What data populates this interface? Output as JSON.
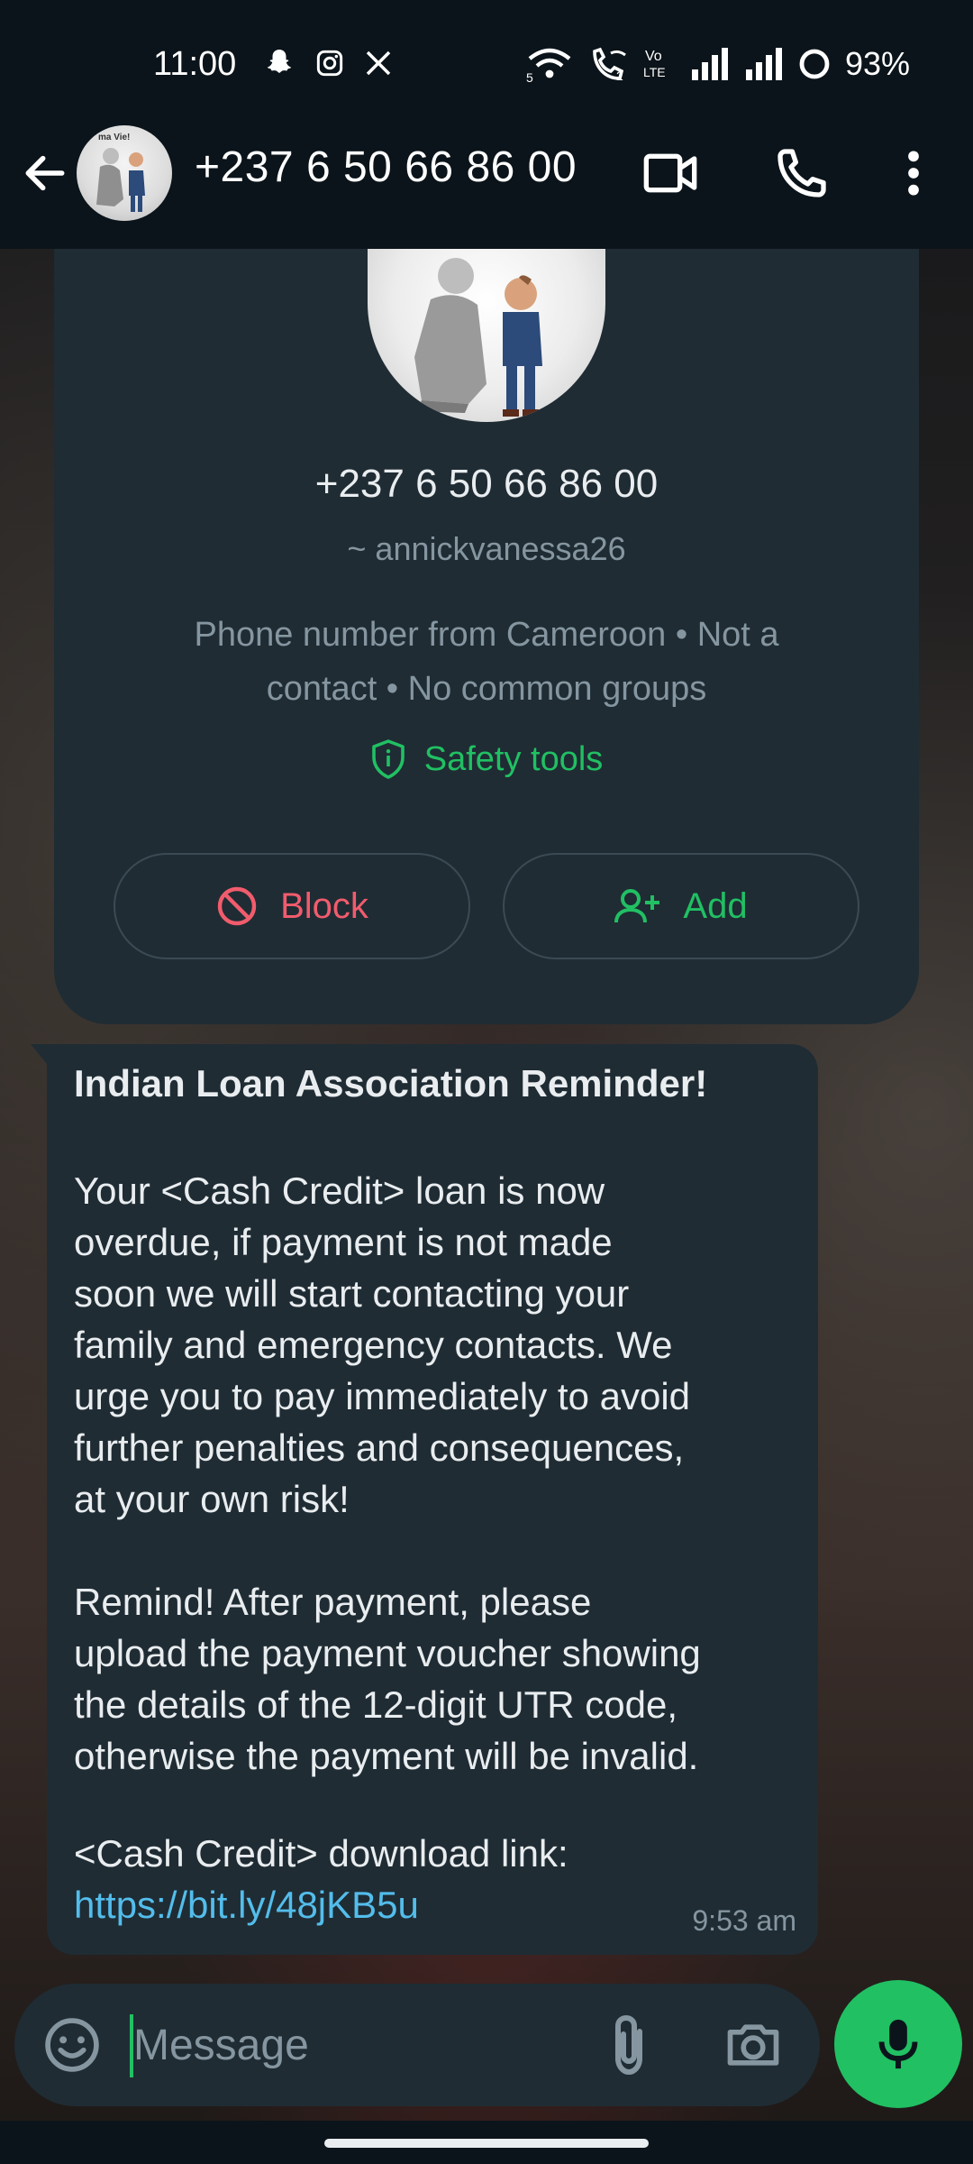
{
  "status_bar": {
    "time": "11:00",
    "battery": "93%",
    "left_icons": [
      "snapchat-icon",
      "instagram-icon",
      "x-icon"
    ],
    "right_icons": [
      "wifi-icon",
      "wifi-calling-icon",
      "volte-icon",
      "signal-icon",
      "signal-icon",
      "battery-icon"
    ],
    "volte_label": "Vo\nLTE"
  },
  "header": {
    "title": "+237 6 50 66 86 00",
    "avatar_caption": "ma Vie!"
  },
  "contact_card": {
    "phone": "+237 6 50 66 86 00",
    "username": "~ annickvanessa26",
    "info_line1": "Phone number from Cameroon • Not a",
    "info_line2": "contact • No common groups",
    "safety_tools": "Safety tools",
    "block_label": "Block",
    "add_label": "Add"
  },
  "message": {
    "title": "Indian Loan Association Reminder!",
    "body": "Your <Cash Credit> loan is now\noverdue, if payment is not made\nsoon we will start contacting your\nfamily and emergency contacts. We\nurge you to pay immediately to avoid\nfurther penalties and consequences,\nat your own risk!\n\nRemind! After payment, please\nupload the payment voucher showing\nthe details of the 12-digit UTR code,\notherwise the payment will be invalid.",
    "link_label": "<Cash Credit> download link:",
    "link": "https://bit.ly/48jKB5u",
    "time": "9:53 am"
  },
  "input": {
    "placeholder": "Message",
    "value": ""
  },
  "colors": {
    "accent": "#21c063",
    "danger": "#f15c6d",
    "link": "#53bdeb",
    "bubble": "#1f2c34",
    "header": "#0b141a"
  }
}
